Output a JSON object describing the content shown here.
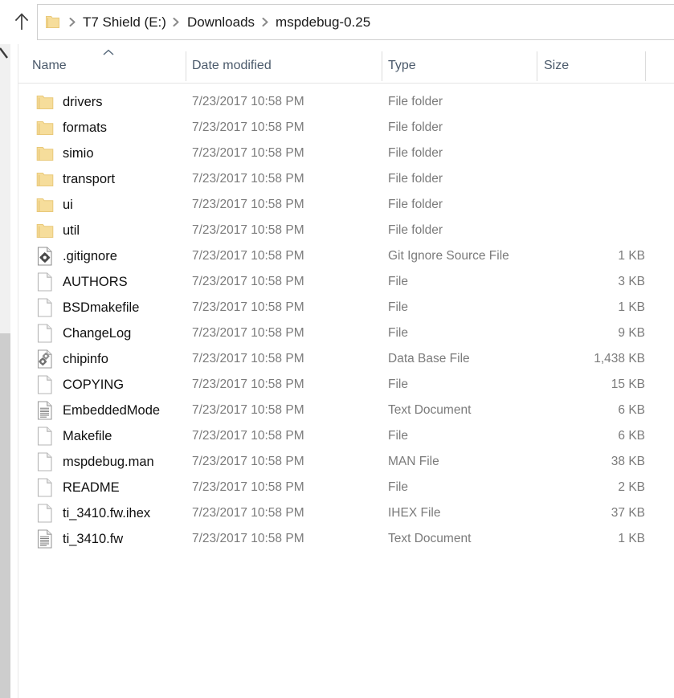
{
  "window": {
    "up_button_tooltip": "Up",
    "address_folder_icon": "folder-icon"
  },
  "breadcrumb": {
    "separator_icon": "chevron-right-icon",
    "items": [
      {
        "label": "T7 Shield (E:)"
      },
      {
        "label": "Downloads"
      },
      {
        "label": "mspdebug-0.25"
      }
    ]
  },
  "columns": {
    "name": "Name",
    "date_modified": "Date modified",
    "type": "Type",
    "size": "Size",
    "sort_column": "Name",
    "sort_direction_icon": "caret-up-icon"
  },
  "files": [
    {
      "name": "drivers",
      "date": "7/23/2017 10:58 PM",
      "type": "File folder",
      "size": "",
      "icon": "folder-icon"
    },
    {
      "name": "formats",
      "date": "7/23/2017 10:58 PM",
      "type": "File folder",
      "size": "",
      "icon": "folder-icon"
    },
    {
      "name": "simio",
      "date": "7/23/2017 10:58 PM",
      "type": "File folder",
      "size": "",
      "icon": "folder-icon"
    },
    {
      "name": "transport",
      "date": "7/23/2017 10:58 PM",
      "type": "File folder",
      "size": "",
      "icon": "folder-icon"
    },
    {
      "name": "ui",
      "date": "7/23/2017 10:58 PM",
      "type": "File folder",
      "size": "",
      "icon": "folder-icon"
    },
    {
      "name": "util",
      "date": "7/23/2017 10:58 PM",
      "type": "File folder",
      "size": "",
      "icon": "folder-icon"
    },
    {
      "name": ".gitignore",
      "date": "7/23/2017 10:58 PM",
      "type": "Git Ignore Source File",
      "size": "1 KB",
      "icon": "gear-file-icon"
    },
    {
      "name": "AUTHORS",
      "date": "7/23/2017 10:58 PM",
      "type": "File",
      "size": "3 KB",
      "icon": "blank-file-icon"
    },
    {
      "name": "BSDmakefile",
      "date": "7/23/2017 10:58 PM",
      "type": "File",
      "size": "1 KB",
      "icon": "blank-file-icon"
    },
    {
      "name": "ChangeLog",
      "date": "7/23/2017 10:58 PM",
      "type": "File",
      "size": "9 KB",
      "icon": "blank-file-icon"
    },
    {
      "name": "chipinfo",
      "date": "7/23/2017 10:58 PM",
      "type": "Data Base File",
      "size": "1,438 KB",
      "icon": "gears-file-icon"
    },
    {
      "name": "COPYING",
      "date": "7/23/2017 10:58 PM",
      "type": "File",
      "size": "15 KB",
      "icon": "blank-file-icon"
    },
    {
      "name": "EmbeddedMode",
      "date": "7/23/2017 10:58 PM",
      "type": "Text Document",
      "size": "6 KB",
      "icon": "text-document-icon"
    },
    {
      "name": "Makefile",
      "date": "7/23/2017 10:58 PM",
      "type": "File",
      "size": "6 KB",
      "icon": "blank-file-icon"
    },
    {
      "name": "mspdebug.man",
      "date": "7/23/2017 10:58 PM",
      "type": "MAN File",
      "size": "38 KB",
      "icon": "blank-file-icon"
    },
    {
      "name": "README",
      "date": "7/23/2017 10:58 PM",
      "type": "File",
      "size": "2 KB",
      "icon": "blank-file-icon"
    },
    {
      "name": "ti_3410.fw.ihex",
      "date": "7/23/2017 10:58 PM",
      "type": "IHEX File",
      "size": "37 KB",
      "icon": "blank-file-icon"
    },
    {
      "name": "ti_3410.fw",
      "date": "7/23/2017 10:58 PM",
      "type": "Text Document",
      "size": "1 KB",
      "icon": "text-document-icon"
    }
  ],
  "scrollbar": {
    "orientation": "vertical",
    "position": "left-edge",
    "arrow_icon": "scroll-arrow-icon"
  },
  "colors": {
    "folder_fill": "#f6dd9b",
    "folder_edge": "#e9c97a",
    "header_text": "#4b5a6b",
    "primary_text": "#101010",
    "secondary_text": "#7b7b7b",
    "scrollbar_thumb": "#cdcdcd",
    "scrollbar_track": "#f0f0f0",
    "background": "#ffffff"
  }
}
